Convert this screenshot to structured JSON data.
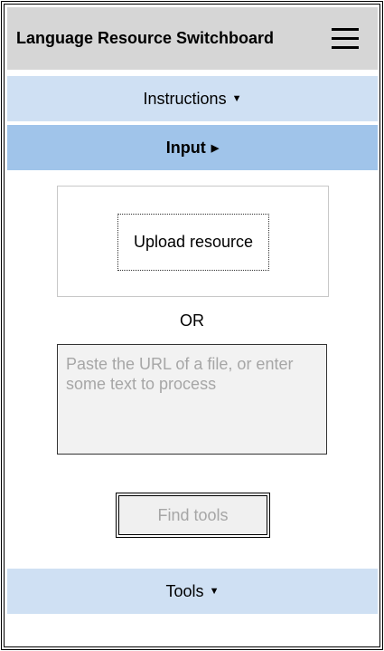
{
  "header": {
    "title": "Language Resource Switchboard",
    "menu_icon": "hamburger-menu-icon"
  },
  "sections": {
    "instructions": {
      "label": "Instructions",
      "caret": "▼"
    },
    "input": {
      "label": "Input",
      "caret": "▶"
    },
    "tools": {
      "label": "Tools",
      "caret": "▼"
    }
  },
  "upload": {
    "button_label": "Upload resource"
  },
  "separator": {
    "label": "OR"
  },
  "url_input": {
    "value": "",
    "placeholder": "Paste the URL of a file, or enter some text to process"
  },
  "find_tools": {
    "label": "Find tools"
  },
  "colors": {
    "header_bg": "#d6d6d6",
    "section_light": "#cfe0f3",
    "section_active": "#a0c4ea",
    "input_bg": "#f2f2f2",
    "disabled_text": "#a6a6a6"
  }
}
